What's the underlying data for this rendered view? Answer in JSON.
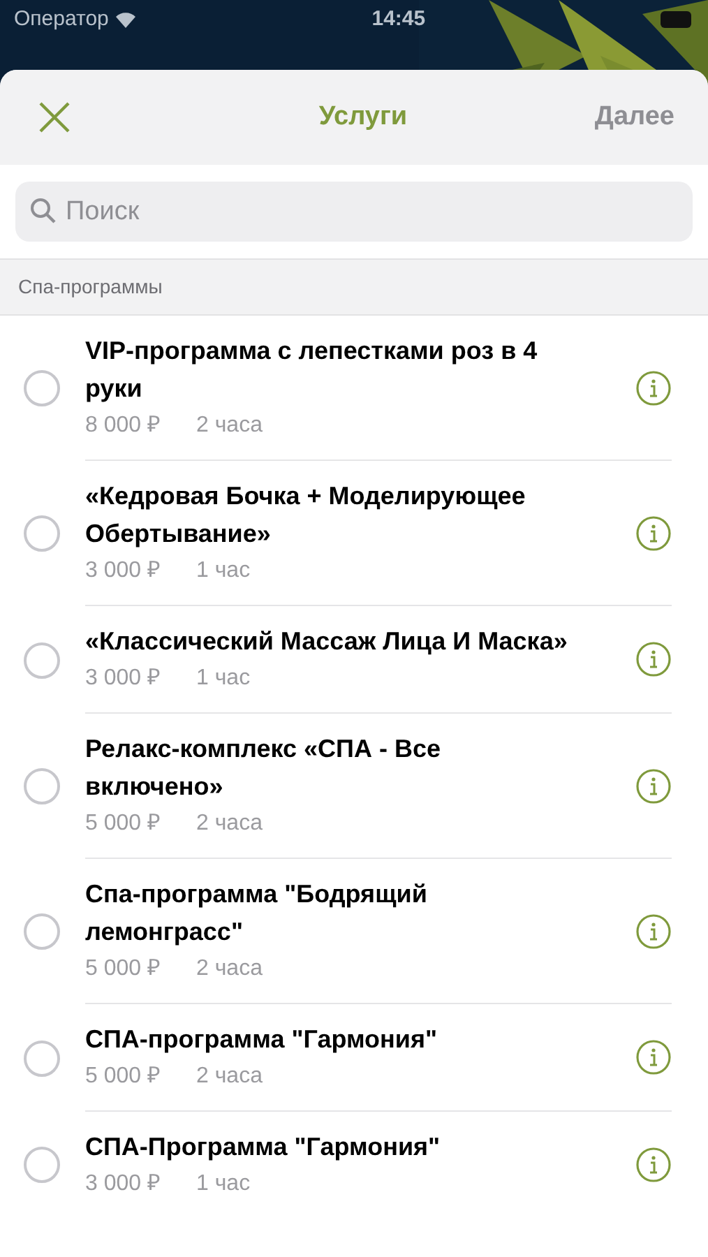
{
  "status_bar": {
    "carrier": "Оператор",
    "time": "14:45"
  },
  "header": {
    "title": "Услуги",
    "next": "Далее",
    "next_disabled": true
  },
  "search": {
    "placeholder": "Поиск"
  },
  "section": {
    "title": "Спа-программы"
  },
  "services": [
    {
      "name": "VIP-программа с лепестками роз в 4 руки",
      "price": "8 000 ₽",
      "duration": "2 часа",
      "selected": false
    },
    {
      "name": "«Кедровая Бочка + Моделирующее Обертывание»",
      "price": "3 000 ₽",
      "duration": "1 час",
      "selected": false
    },
    {
      "name": "«Классический Массаж Лица И Маска»",
      "price": "3 000 ₽",
      "duration": "1 час",
      "selected": false
    },
    {
      "name": "Релакс-комплекс «СПА - Все включено»",
      "price": "5 000 ₽",
      "duration": "2 часа",
      "selected": false
    },
    {
      "name": "Спа-программа \"Бодрящий лемонграсс\"",
      "price": "5 000 ₽",
      "duration": "2 часа",
      "selected": false
    },
    {
      "name": "СПА-программа \"Гармония\"",
      "price": "5 000 ₽",
      "duration": "2 часа",
      "selected": false
    },
    {
      "name": "СПА-Программа \"Гармония\"",
      "price": "3 000 ₽",
      "duration": "1 час",
      "selected": false
    }
  ]
}
